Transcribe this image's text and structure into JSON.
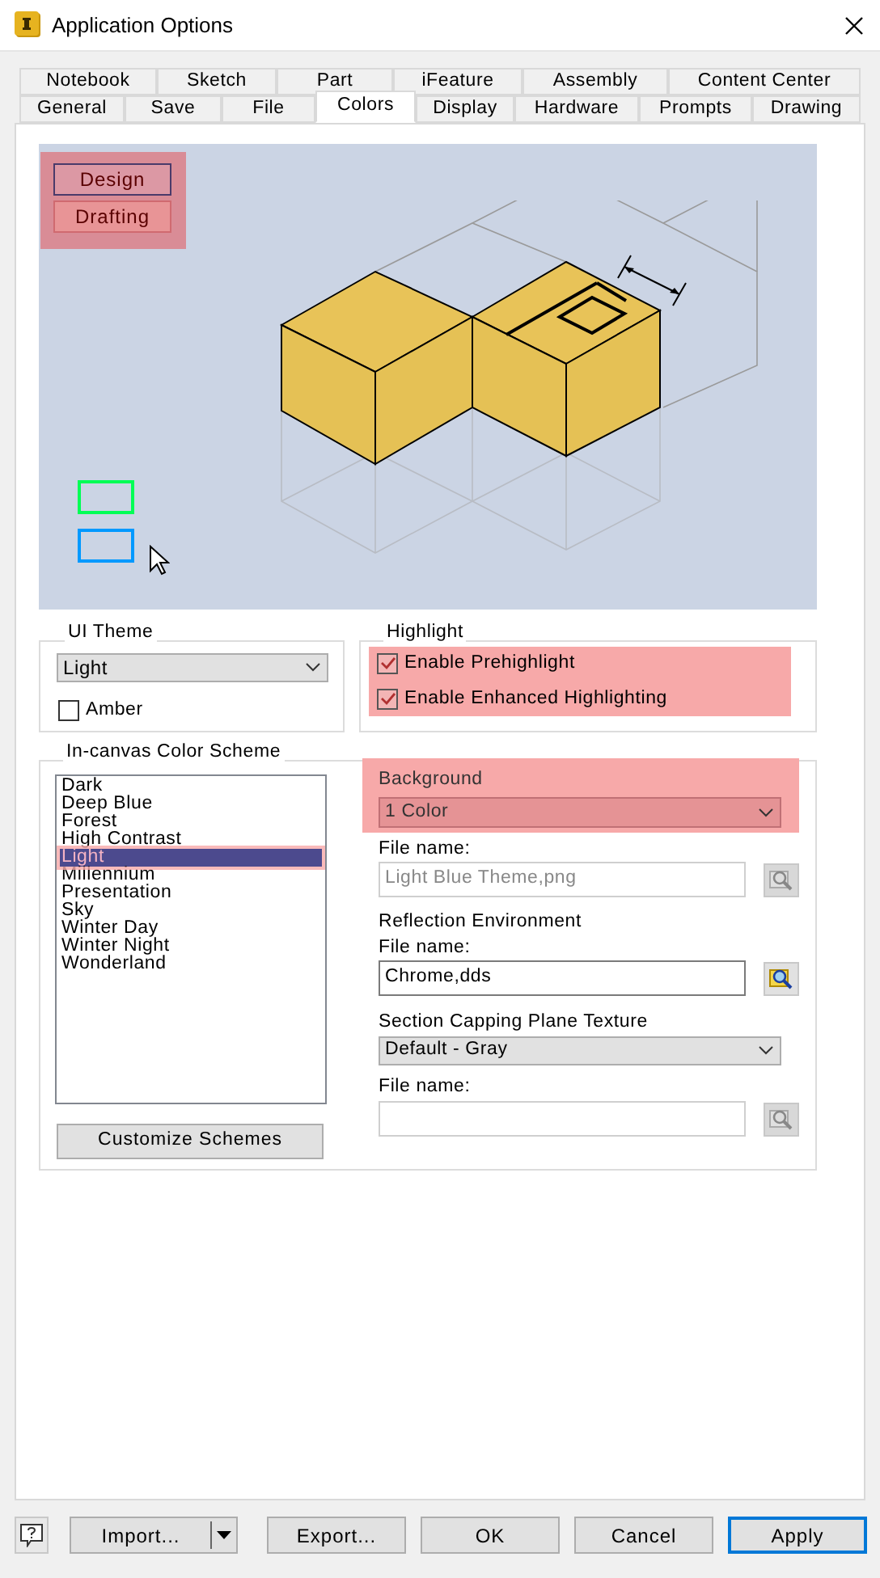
{
  "window": {
    "title": "Application Options"
  },
  "tabs_row_1": [
    {
      "label": "Notebook"
    },
    {
      "label": "Sketch"
    },
    {
      "label": "Part"
    },
    {
      "label": "iFeature"
    },
    {
      "label": "Assembly"
    },
    {
      "label": "Content Center"
    }
  ],
  "tabs_row_2": [
    {
      "label": "General",
      "selected": false
    },
    {
      "label": "Save",
      "selected": false
    },
    {
      "label": "File",
      "selected": false
    },
    {
      "label": "Colors",
      "selected": true
    },
    {
      "label": "Display",
      "selected": false
    },
    {
      "label": "Hardware",
      "selected": false
    },
    {
      "label": "Prompts",
      "selected": false
    },
    {
      "label": "Drawing",
      "selected": false
    }
  ],
  "preview": {
    "modes": [
      {
        "label": "Design",
        "selected": true
      },
      {
        "label": "Drafting",
        "selected": false
      }
    ]
  },
  "ui_theme": {
    "label": "UI Theme",
    "value": "Light",
    "amber": {
      "label": "Amber",
      "checked": false
    }
  },
  "highlight": {
    "label": "Highlight",
    "options": [
      {
        "label": "Enable Prehighlight",
        "checked": true
      },
      {
        "label": "Enable Enhanced Highlighting",
        "checked": true
      }
    ]
  },
  "color_scheme": {
    "label": "In-canvas Color Scheme",
    "schemes": [
      {
        "label": "Dark",
        "selected": false
      },
      {
        "label": "Deep Blue",
        "selected": false
      },
      {
        "label": "Forest",
        "selected": false
      },
      {
        "label": "High Contrast",
        "selected": false
      },
      {
        "label": "Light",
        "selected": true
      },
      {
        "label": "Millennium",
        "selected": false
      },
      {
        "label": "Presentation",
        "selected": false
      },
      {
        "label": "Sky",
        "selected": false
      },
      {
        "label": "Winter Day",
        "selected": false
      },
      {
        "label": "Winter Night",
        "selected": false
      },
      {
        "label": "Wonderland",
        "selected": false
      }
    ],
    "button": "Customize Schemes"
  },
  "background": {
    "label": "Background",
    "value": "1 Color",
    "file_label": "File name:",
    "file_value": "Light Blue Theme,png",
    "disabled": true
  },
  "reflection": {
    "label": "Reflection Environment",
    "file_label": "File name:",
    "file_value": "Chrome,dds",
    "disabled": false
  },
  "section_capping": {
    "label": "Section Capping Plane Texture",
    "value": "Default - Gray",
    "file_label": "File name:",
    "disabled": true
  },
  "buttons": [
    {
      "label": "Import...",
      "kind": "split"
    },
    {
      "label": "Export...",
      "kind": "plain"
    },
    {
      "label": "OK",
      "kind": "plain"
    },
    {
      "label": "Cancel",
      "kind": "plain"
    },
    {
      "label": "Apply",
      "kind": "default"
    }
  ]
}
